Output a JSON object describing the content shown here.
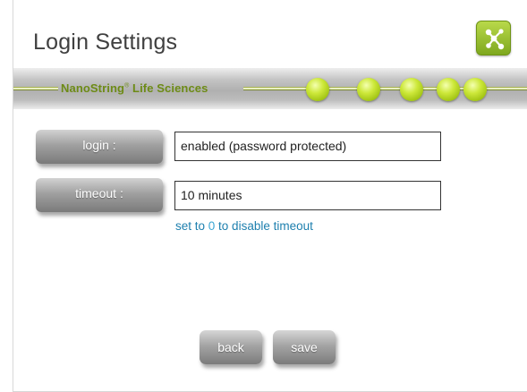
{
  "header": {
    "title": "Login Settings",
    "app_icon": "network-icon"
  },
  "brand": {
    "name": "NanoString",
    "registered_mark": "®",
    "suffix": "Life Sciences",
    "accent_color": "#6d8b16"
  },
  "settings": {
    "login_label": "login :",
    "login_value": "enabled (password protected)",
    "timeout_label": "timeout :",
    "timeout_value": "10 minutes",
    "hint_before": "set to ",
    "hint_zero": "0",
    "hint_after": " to disable timeout"
  },
  "actions": {
    "back_label": "back",
    "save_label": "save"
  },
  "colors": {
    "hint": "#1d7fae",
    "brand_green": "#9cbf0f"
  }
}
